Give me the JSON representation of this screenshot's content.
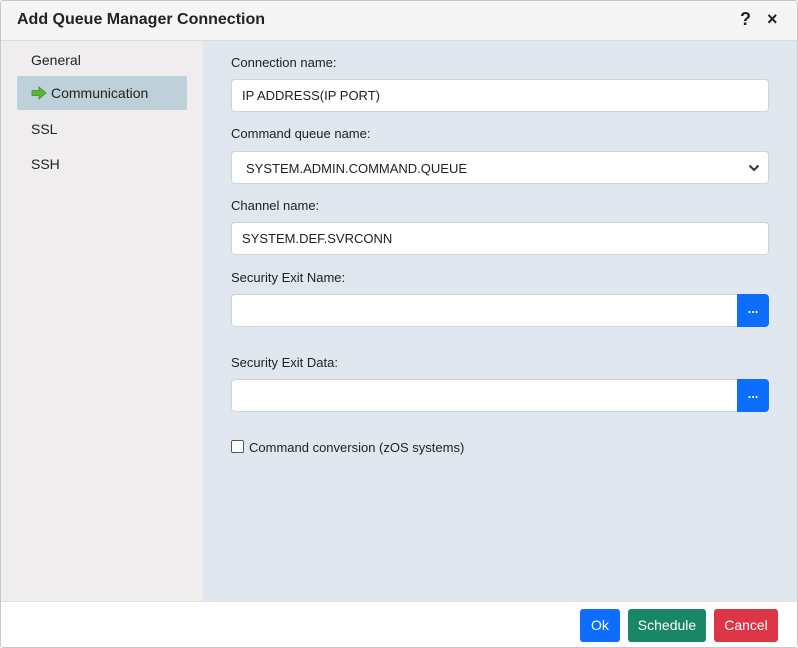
{
  "dialog": {
    "title": "Add Queue Manager Connection",
    "help": "?",
    "close": "×"
  },
  "sidebar": {
    "items": [
      {
        "label": "General",
        "active": false
      },
      {
        "label": "Communication",
        "active": true
      },
      {
        "label": "SSL",
        "active": false
      },
      {
        "label": "SSH",
        "active": false
      }
    ]
  },
  "form": {
    "connection_name": {
      "label": "Connection name:",
      "value": "IP ADDRESS(IP PORT)"
    },
    "command_queue_name": {
      "label": "Command queue name:",
      "value": "SYSTEM.ADMIN.COMMAND.QUEUE"
    },
    "channel_name": {
      "label": "Channel name:",
      "value": "SYSTEM.DEF.SVRCONN"
    },
    "security_exit_name": {
      "label": "Security Exit Name:",
      "value": "",
      "browse_label": "..."
    },
    "security_exit_data": {
      "label": "Security Exit Data:",
      "value": "",
      "browse_label": "..."
    },
    "command_conversion": {
      "label": "Command conversion (zOS systems)",
      "checked": false
    }
  },
  "footer": {
    "ok_label": "Ok",
    "schedule_label": "Schedule",
    "cancel_label": "Cancel"
  },
  "colors": {
    "primary": "#0d6efd",
    "success": "#198765",
    "danger": "#dc3545",
    "active_nav": "#bed1da",
    "content_bg": "#e1e7ef",
    "sidebar_bg": "#efeded",
    "arrow": "#5cb531"
  }
}
